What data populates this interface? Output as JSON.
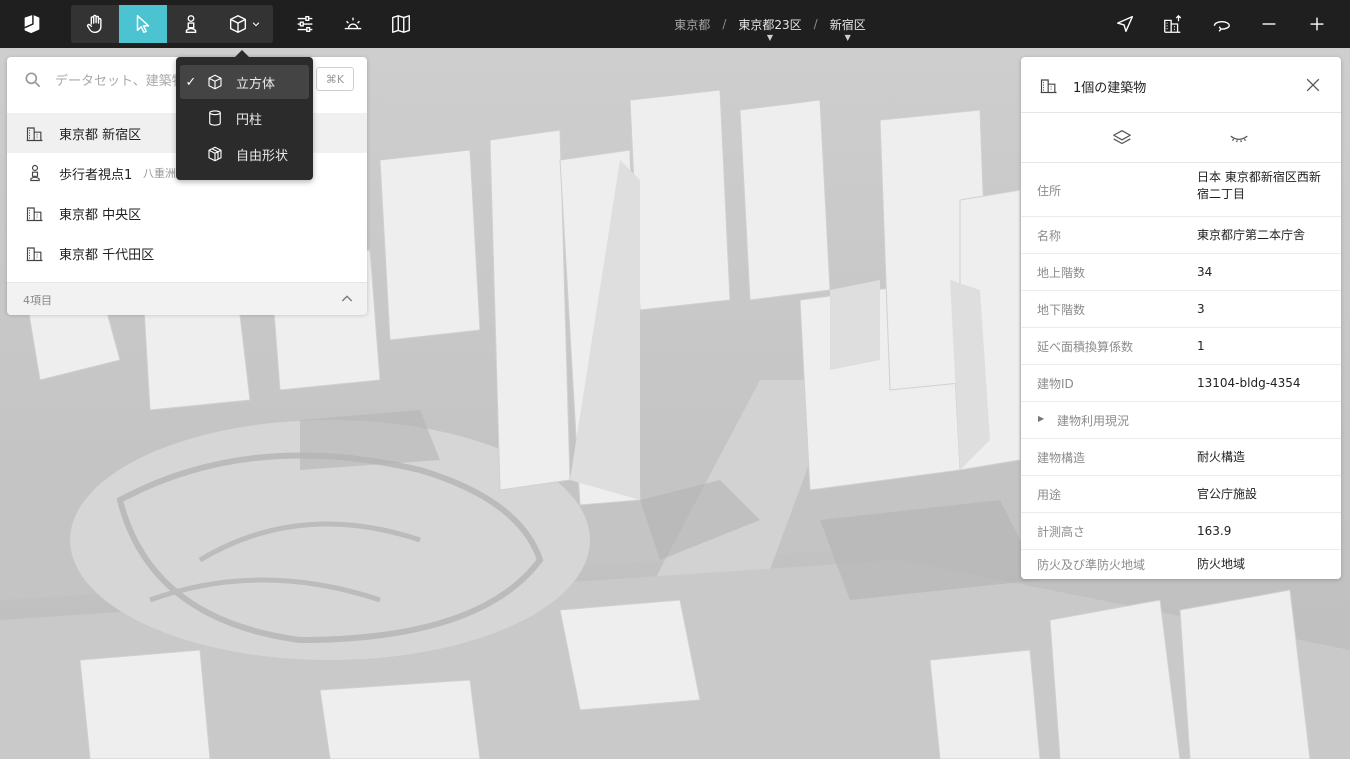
{
  "toolbar": {
    "tools": [
      {
        "id": "hand",
        "icon": "hand-icon",
        "active": false
      },
      {
        "id": "select",
        "icon": "cursor-icon",
        "active": true
      },
      {
        "id": "pedestrian",
        "icon": "pedestrian-icon",
        "active": false
      },
      {
        "id": "shape",
        "icon": "cube-icon",
        "active": false
      }
    ],
    "extra_icons": [
      "settings-sliders-icon",
      "sun-horizon-icon",
      "map-icon"
    ],
    "right_icons": [
      "navigation-arrow-icon",
      "building-upload-icon",
      "orbit-icon",
      "zoom-out-icon",
      "zoom-in-icon"
    ]
  },
  "breadcrumb": {
    "items": [
      {
        "label": "東京都",
        "has_dropdown": false
      },
      {
        "label": "東京都23区",
        "has_dropdown": true
      },
      {
        "label": "新宿区",
        "has_dropdown": true
      }
    ],
    "separator": "/"
  },
  "shape_menu": {
    "items": [
      {
        "label": "立方体",
        "icon": "cube-icon",
        "selected": true
      },
      {
        "label": "円柱",
        "icon": "cylinder-icon",
        "selected": false
      },
      {
        "label": "自由形状",
        "icon": "freeform-icon",
        "selected": false
      }
    ],
    "check": "✓"
  },
  "search": {
    "placeholder": "データセット、建築物、住所を検索",
    "shortcut": "⌘K",
    "results": [
      {
        "label": "東京都 新宿区",
        "icon": "building-icon",
        "sub": ""
      },
      {
        "label": "歩行者視点1",
        "icon": "pedestrian-icon",
        "sub": "八重洲"
      },
      {
        "label": "東京都 中央区",
        "icon": "building-icon",
        "sub": ""
      },
      {
        "label": "東京都 千代田区",
        "icon": "building-icon",
        "sub": ""
      }
    ],
    "count_label": "4項目"
  },
  "inspector": {
    "title": "1個の建築物",
    "properties": [
      {
        "key": "住所",
        "value": "日本 東京都新宿区西新宿二丁目"
      },
      {
        "key": "名称",
        "value": "東京都庁第二本庁舎"
      },
      {
        "key": "地上階数",
        "value": "34"
      },
      {
        "key": "地下階数",
        "value": "3"
      },
      {
        "key": "延べ面積換算係数",
        "value": "1"
      },
      {
        "key": "建物ID",
        "value": "13104-bldg-4354"
      },
      {
        "key": "建物利用現況",
        "value": "",
        "expandable": true
      },
      {
        "key": "建物構造",
        "value": "耐火構造"
      },
      {
        "key": "用途",
        "value": "官公庁施設"
      },
      {
        "key": "計測高さ",
        "value": "163.9"
      },
      {
        "key": "防火及び準防火地域",
        "value": "防火地域"
      }
    ]
  },
  "colors": {
    "topbar": "#1f1f1f",
    "accent": "#4cc3d0",
    "panel": "#ffffff"
  }
}
